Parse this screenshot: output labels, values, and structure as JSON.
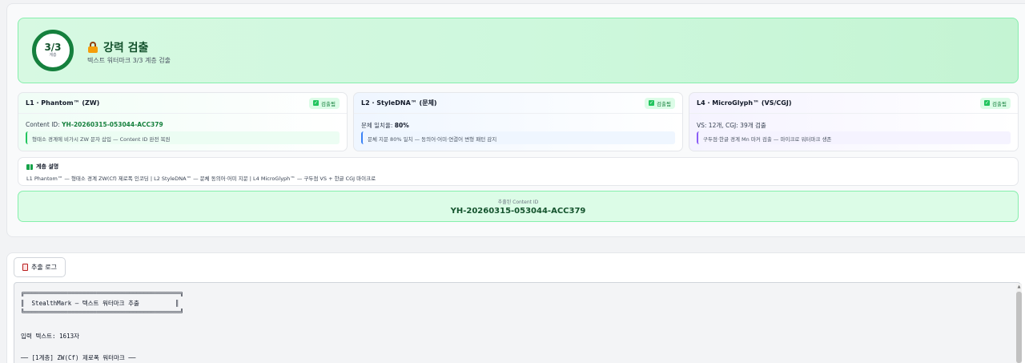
{
  "hero": {
    "score": "3/3",
    "score_unit": "계층",
    "title": "강력 검출",
    "subtitle": "텍스트 워터마크 3/3 계층 검출"
  },
  "cards": [
    {
      "title": "L1 · Phantom™ (ZW)",
      "badge": "검출됨",
      "line_label": "Content ID: ",
      "line_value": "YH-20260315-053044-ACC379",
      "note": "형태소 경계에 비가시 ZW 문자 삽입 — Content ID 완전 복원"
    },
    {
      "title": "L2 · StyleDNA™ (문체)",
      "badge": "검출됨",
      "line_label": "문체 일치율: ",
      "line_value": "80%",
      "note": "문체 지문 80% 일치 — 동의어·어미·연결어 변형 패턴 감지"
    },
    {
      "title": "L4 · MicroGlyph™ (VS/CGJ)",
      "badge": "검출됨",
      "line_label": "VS: 12개, CGJ: 39개 검출",
      "line_value": "",
      "note": "구두점·한글 경계 Mn 마커 검출 — 마이크로 워터마크 생존"
    }
  ],
  "legend": {
    "title": "계층 설명",
    "text": "L1 Phantom™ — 형태소 경계 ZW(Cf) 제로폭 인코딩 | L2 StyleDNA™ — 문체 동의어·어미 지문 | L4 MicroGlyph™ — 구두점 VS + 한글 CGJ 마이크로"
  },
  "content_id": {
    "label": "추출된 Content ID",
    "value": "YH-20260315-053044-ACC379"
  },
  "log": {
    "button_label": "추출 로그",
    "lines": [
      "╔═══════════════════════════════════════════╗",
      "║  StealthMark — 텍스트 워터마크 추출          ║",
      "╚═══════════════════════════════════════════╝",
      "",
      "입력 텍스트: 1613자",
      "",
      "── [1계층] ZW(Cf) 제로폭 워터마크 ──"
    ]
  },
  "icons": {
    "hero": "lock-icon",
    "badge": "check-icon",
    "legend": "book-icon",
    "log_button": "clipboard-icon"
  },
  "colors": {
    "accent_green": "#15803d",
    "success_bg": "#dcfce7"
  }
}
